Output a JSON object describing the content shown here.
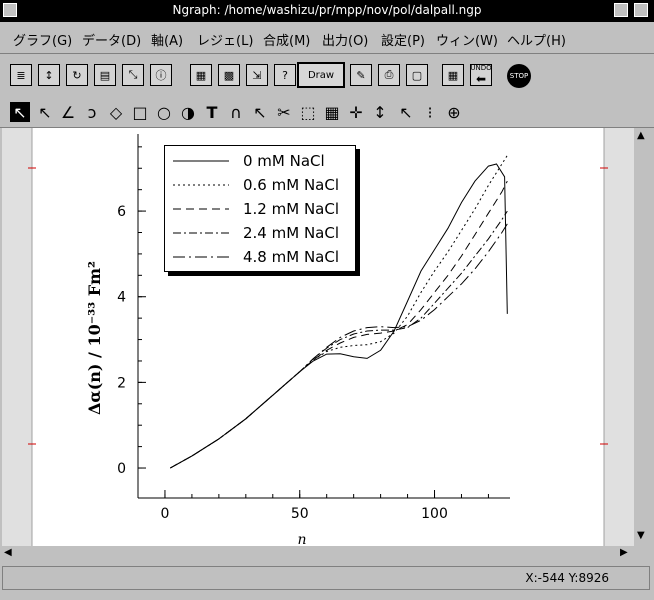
{
  "window": {
    "title": "Ngraph: /home/washizu/pr/mpp/nov/pol/dalpall.ngp"
  },
  "menu": [
    "グラフ(G)",
    "データ(D)",
    "軸(A)",
    "レジェ(L)",
    "合成(M)",
    "出力(O)",
    "設定(P)",
    "ウィン(W)",
    "ヘルプ(H)"
  ],
  "toolbar": {
    "draw_label": "Draw",
    "undo_label": "UNDO",
    "stop_label": "STOP"
  },
  "status": {
    "coords": "X:-544 Y:8926"
  },
  "chart_data": {
    "type": "line",
    "xlabel": "n",
    "ylabel": "Δα(n) / 10⁻³³ Fm²",
    "xlim": [
      -10,
      128
    ],
    "ylim": [
      -0.7,
      7.8
    ],
    "xticks": [
      "0",
      "50",
      "100"
    ],
    "yticks": [
      "0",
      "2",
      "4",
      "6"
    ],
    "legend_placement": "top-left",
    "series": [
      {
        "name": "0 mM NaCl",
        "style": "solid",
        "x": [
          2,
          10,
          20,
          30,
          40,
          50,
          55,
          60,
          65,
          70,
          75,
          80,
          85,
          90,
          95,
          100,
          105,
          110,
          115,
          120,
          123,
          126,
          127
        ],
        "y": [
          0,
          0.28,
          0.68,
          1.15,
          1.7,
          2.25,
          2.5,
          2.66,
          2.67,
          2.6,
          2.56,
          2.75,
          3.2,
          3.9,
          4.6,
          5.1,
          5.6,
          6.2,
          6.7,
          7.05,
          7.1,
          6.8,
          3.6
        ]
      },
      {
        "name": "0.6 mM NaCl",
        "style": "dotted",
        "x": [
          2,
          10,
          20,
          30,
          40,
          50,
          55,
          60,
          65,
          70,
          75,
          80,
          85,
          90,
          95,
          100,
          105,
          110,
          115,
          120,
          124,
          127
        ],
        "y": [
          0,
          0.28,
          0.68,
          1.15,
          1.7,
          2.25,
          2.52,
          2.72,
          2.82,
          2.86,
          2.88,
          2.95,
          3.15,
          3.55,
          4.1,
          4.6,
          5.05,
          5.55,
          6.05,
          6.6,
          7.0,
          7.3
        ]
      },
      {
        "name": "1.2 mM NaCl",
        "style": "dashed",
        "x": [
          2,
          10,
          20,
          30,
          40,
          50,
          55,
          60,
          65,
          70,
          75,
          80,
          85,
          90,
          95,
          100,
          105,
          110,
          115,
          120,
          125,
          127
        ],
        "y": [
          0,
          0.28,
          0.68,
          1.15,
          1.7,
          2.25,
          2.52,
          2.75,
          2.92,
          3.05,
          3.12,
          3.15,
          3.2,
          3.35,
          3.7,
          4.1,
          4.5,
          4.95,
          5.45,
          5.95,
          6.45,
          6.7
        ]
      },
      {
        "name": "2.4 mM NaCl",
        "style": "dash-dot",
        "x": [
          2,
          10,
          20,
          30,
          40,
          50,
          55,
          60,
          65,
          70,
          75,
          80,
          85,
          90,
          95,
          100,
          105,
          110,
          115,
          120,
          125,
          127
        ],
        "y": [
          0,
          0.28,
          0.68,
          1.15,
          1.7,
          2.25,
          2.55,
          2.8,
          3.0,
          3.13,
          3.2,
          3.22,
          3.22,
          3.28,
          3.5,
          3.85,
          4.2,
          4.55,
          4.95,
          5.35,
          5.8,
          6.0
        ]
      },
      {
        "name": "4.8 mM NaCl",
        "style": "long-dash-dot",
        "x": [
          2,
          10,
          20,
          30,
          40,
          50,
          55,
          60,
          65,
          70,
          75,
          80,
          85,
          90,
          95,
          100,
          105,
          110,
          115,
          120,
          125,
          127
        ],
        "y": [
          0,
          0.28,
          0.68,
          1.15,
          1.7,
          2.25,
          2.55,
          2.82,
          3.05,
          3.2,
          3.28,
          3.3,
          3.28,
          3.3,
          3.45,
          3.7,
          4.0,
          4.3,
          4.65,
          5.05,
          5.5,
          5.7
        ]
      }
    ]
  }
}
